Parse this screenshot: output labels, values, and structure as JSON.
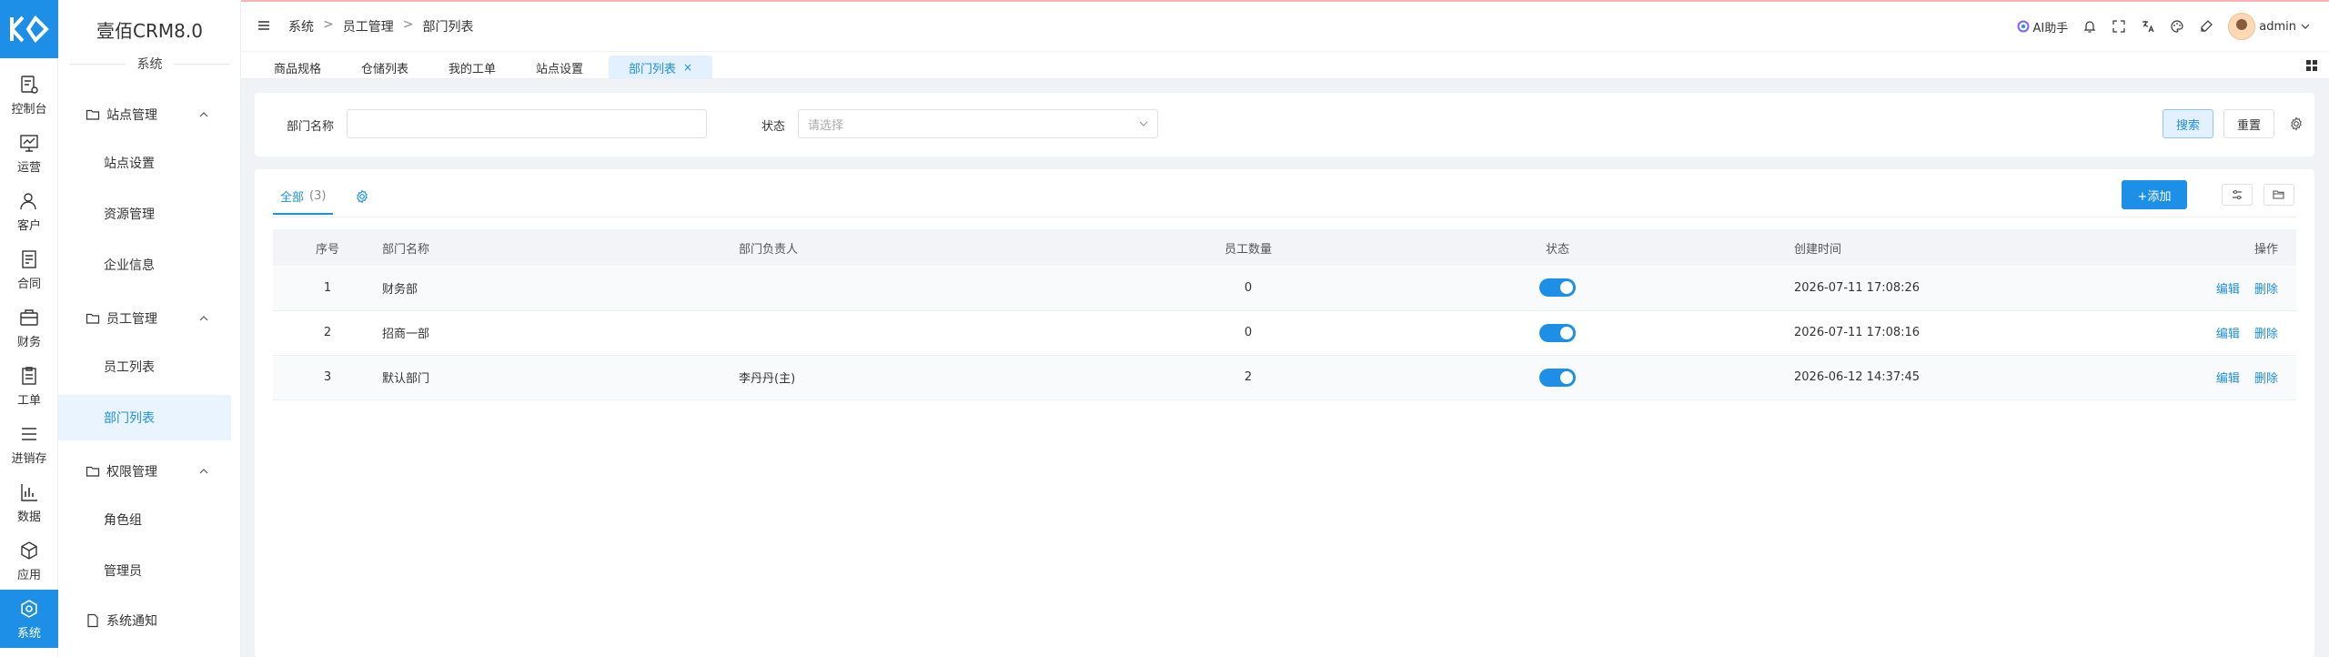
{
  "app": {
    "name": "壹佰CRM8.0",
    "section": "系统"
  },
  "rail": [
    {
      "label": "控制台",
      "icon": "dashboard-icon"
    },
    {
      "label": "运营",
      "icon": "operations-icon"
    },
    {
      "label": "客户",
      "icon": "customer-icon"
    },
    {
      "label": "合同",
      "icon": "contract-icon"
    },
    {
      "label": "财务",
      "icon": "finance-icon"
    },
    {
      "label": "工单",
      "icon": "ticket-icon"
    },
    {
      "label": "进销存",
      "icon": "inventory-icon"
    },
    {
      "label": "数据",
      "icon": "data-icon"
    },
    {
      "label": "应用",
      "icon": "app-icon"
    },
    {
      "label": "系统",
      "icon": "system-icon",
      "active": true
    }
  ],
  "sidebar": {
    "groups": [
      {
        "label": "站点管理",
        "items": [
          "站点设置",
          "资源管理",
          "企业信息"
        ]
      },
      {
        "label": "员工管理",
        "items": [
          "员工列表",
          "部门列表"
        ]
      },
      {
        "label": "权限管理",
        "items": [
          "角色组",
          "管理员"
        ]
      }
    ],
    "notice": "系统通知",
    "active_item": "部门列表"
  },
  "header": {
    "breadcrumb": [
      "系统",
      "员工管理",
      "部门列表"
    ],
    "breadcrumb_sep": ">",
    "ai_label": "AI助手",
    "user": "admin"
  },
  "tabs": [
    {
      "label": "商品规格"
    },
    {
      "label": "仓储列表"
    },
    {
      "label": "我的工单"
    },
    {
      "label": "站点设置"
    },
    {
      "label": "部门列表",
      "active": true,
      "close": "×"
    }
  ],
  "search": {
    "name_label": "部门名称",
    "name_value": "",
    "status_label": "状态",
    "status_placeholder": "请选择",
    "search_btn": "搜索",
    "reset_btn": "重置"
  },
  "list": {
    "filter_tab": "全部",
    "filter_count": "(3)",
    "add_btn": "+添加",
    "columns": [
      "序号",
      "部门名称",
      "部门负责人",
      "员工数量",
      "状态",
      "创建时间",
      "操作"
    ],
    "rows": [
      {
        "idx": "1",
        "name": "财务部",
        "lead": "",
        "count": "0",
        "status": true,
        "time": "2026-07-11 17:08:26"
      },
      {
        "idx": "2",
        "name": "招商一部",
        "lead": "",
        "count": "0",
        "status": true,
        "time": "2026-07-11 17:08:16"
      },
      {
        "idx": "3",
        "name": "默认部门",
        "lead": "李丹丹(主)",
        "count": "2",
        "status": true,
        "time": "2026-06-12 14:37:45"
      }
    ],
    "op_edit": "编辑",
    "op_delete": "删除"
  },
  "colors": {
    "primary": "#1d8fe6",
    "active_bg": "#eaf4ff"
  }
}
